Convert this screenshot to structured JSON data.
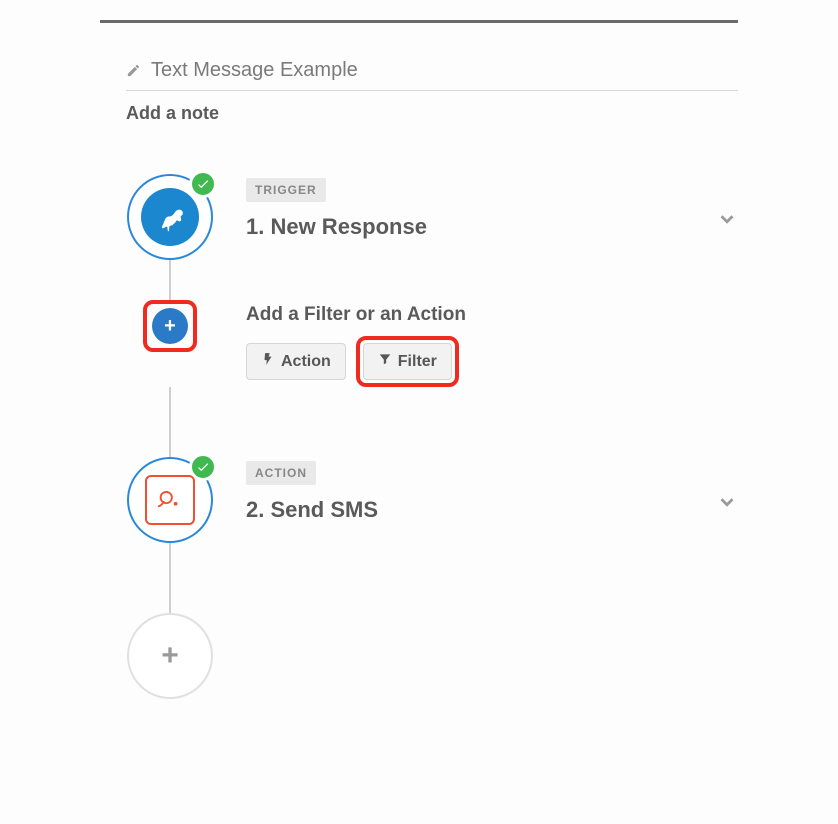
{
  "workflow": {
    "title": "Text Message Example",
    "add_note_label": "Add a note"
  },
  "steps": {
    "trigger": {
      "tag": "TRIGGER",
      "title": "1. New Response"
    },
    "middle": {
      "prompt": "Add a Filter or an Action",
      "action_button": "Action",
      "filter_button": "Filter"
    },
    "action": {
      "tag": "ACTION",
      "title": "2. Send SMS"
    }
  },
  "icons": {
    "plus": "+",
    "end_plus": "+"
  }
}
